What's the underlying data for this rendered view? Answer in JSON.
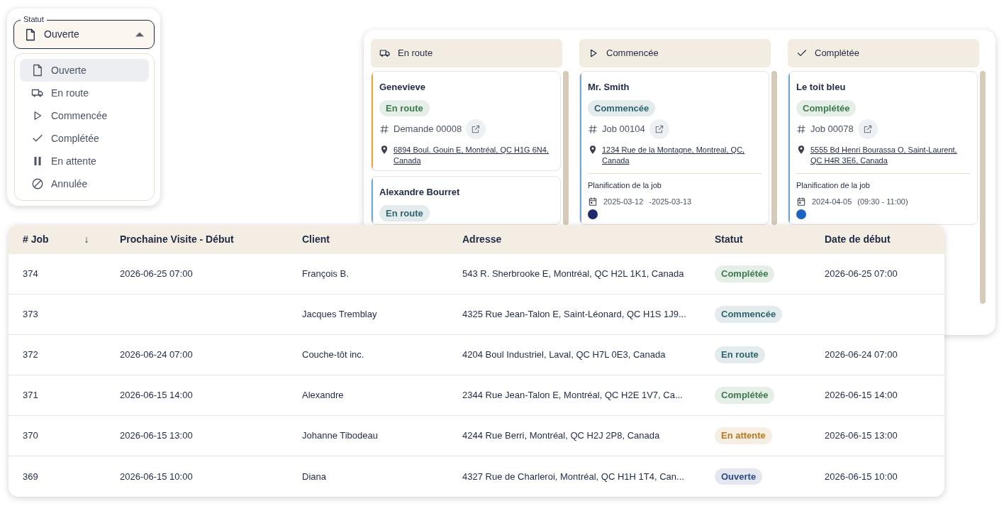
{
  "status_select": {
    "label": "Statut",
    "value": "Ouverte",
    "expanded": true,
    "options": [
      {
        "label": "Ouverte",
        "kind": "open",
        "selected": true
      },
      {
        "label": "En route",
        "kind": "transit",
        "selected": false
      },
      {
        "label": "Commencée",
        "kind": "started",
        "selected": false
      },
      {
        "label": "Complétée",
        "kind": "done",
        "selected": false
      },
      {
        "label": "En attente",
        "kind": "hold",
        "selected": false
      },
      {
        "label": "Annulée",
        "kind": "cancelled",
        "selected": false
      }
    ]
  },
  "board": {
    "columns": [
      {
        "title": "En route",
        "kind": "transit",
        "cards": [
          {
            "client": "Genevieve",
            "status": {
              "label": "En route",
              "color": "#3d7a4e"
            },
            "color": "#f0a830",
            "reference": "Demande 00008",
            "address": "6894 Boul. Gouin E, Montréal, QC H1G 6N4, Canada"
          },
          {
            "client": "Alexandre Bourret",
            "status": {
              "label": "En route",
              "color": "#2f6570"
            },
            "color": "#6fa8dc"
          }
        ]
      },
      {
        "title": "Commencée",
        "kind": "started",
        "cards": [
          {
            "client": "Mr. Smith",
            "status": {
              "label": "Commencée",
              "color": "#2f6570"
            },
            "color": "#6fa8dc",
            "reference": "Job 00104",
            "address": "1234 Rue de la Montagne, Montreal, QC, Canada",
            "schedule": {
              "label": "Planification de la job",
              "date": "2025-03-12",
              "time": "-2025-03-13"
            },
            "assignee": {
              "color": "#1f2a6e"
            }
          }
        ]
      },
      {
        "title": "Complétée",
        "kind": "done",
        "cards": [
          {
            "client": "Le toit bleu",
            "status": {
              "label": "Complétée",
              "color": "#3d7a4e"
            },
            "color": "#6fa8dc",
            "reference": "Job 00078",
            "address": "5555 Bd Henri Bourassa O, Saint-Laurent, QC H4R 3E6, Canada",
            "schedule": {
              "label": "Planification de la job",
              "date": "2024-04-05",
              "time": "(09:30 - 11:00)"
            },
            "assignee": {
              "color": "#1c64c4"
            }
          }
        ]
      }
    ]
  },
  "table": {
    "columns": [
      {
        "label": "# Job",
        "sort_indicator": "↓"
      },
      {
        "label": "Prochaine Visite - Début"
      },
      {
        "label": "Client"
      },
      {
        "label": "Adresse"
      },
      {
        "label": "Statut"
      },
      {
        "label": "Date de début"
      }
    ],
    "rows": [
      {
        "job": "374",
        "next_visit": "2026-06-25 07:00",
        "client": "François B.",
        "address": "543 R. Sherbrooke E, Montréal, QC H2L 1K1, Canada",
        "status": {
          "label": "Complétée",
          "color": "#3d7a4e"
        },
        "start_date": "2026-06-25 07:00"
      },
      {
        "job": "373",
        "client": "Jacques Tremblay",
        "address": "4325 Rue Jean-Talon E, Saint-Léonard, QC H1S 1J9...",
        "status": {
          "label": "Commencée",
          "color": "#2f6570"
        }
      },
      {
        "job": "372",
        "next_visit": "2026-06-24 07:00",
        "client": "Couche-tôt inc.",
        "address": "4204 Boul Industriel, Laval, QC H7L 0E3, Canada",
        "status": {
          "label": "En route",
          "color": "#2f6570"
        },
        "start_date": "2026-06-24 07:00"
      },
      {
        "job": "371",
        "next_visit": "2026-06-15 14:00",
        "client": "Alexandre",
        "address": "2344 Rue Jean-Talon E, Montréal, QC H2E 1V7, Ca...",
        "status": {
          "label": "Complétée",
          "color": "#3d7a4e"
        },
        "start_date": "2026-06-15 14:00"
      },
      {
        "job": "370",
        "next_visit": "2026-06-15 13:00",
        "client": "Johanne Tibodeau",
        "address": "4244 Rue Berri, Montréal, QC H2J 2P8, Canada",
        "status": {
          "label": "En attente",
          "color": "#b7791f"
        },
        "start_date": "2026-06-15 13:00"
      },
      {
        "job": "369",
        "next_visit": "2026-06-15 10:00",
        "client": "Diana",
        "address": "4327 Rue de Charleroi, Montréal, QC H1H 1T4, Can...",
        "status": {
          "label": "Ouverte",
          "color": "#2d4a86"
        },
        "start_date": "2026-06-15 10:00"
      }
    ]
  }
}
